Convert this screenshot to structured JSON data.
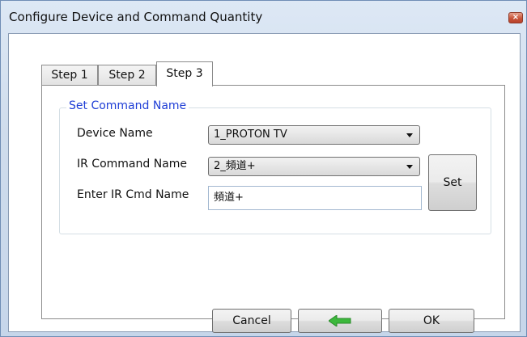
{
  "window": {
    "title": "Configure Device and Command Quantity"
  },
  "tabs": [
    {
      "label": "Step 1"
    },
    {
      "label": "Step 2"
    },
    {
      "label": "Step 3",
      "active": true
    }
  ],
  "group": {
    "title": "Set Command Name",
    "device_name": {
      "label": "Device Name",
      "selected": "1_PROTON TV"
    },
    "ir_command": {
      "label": "IR Command Name",
      "selected": "2_頻道+"
    },
    "ir_cmd_name": {
      "label": "Enter IR Cmd Name",
      "value": "頻道+"
    },
    "set_button": "Set"
  },
  "footer": {
    "cancel": "Cancel",
    "back_icon": "left-arrow-icon",
    "ok": "OK"
  },
  "colors": {
    "accent_legend": "#1f3ed6",
    "back_arrow": "#3cb83c"
  }
}
